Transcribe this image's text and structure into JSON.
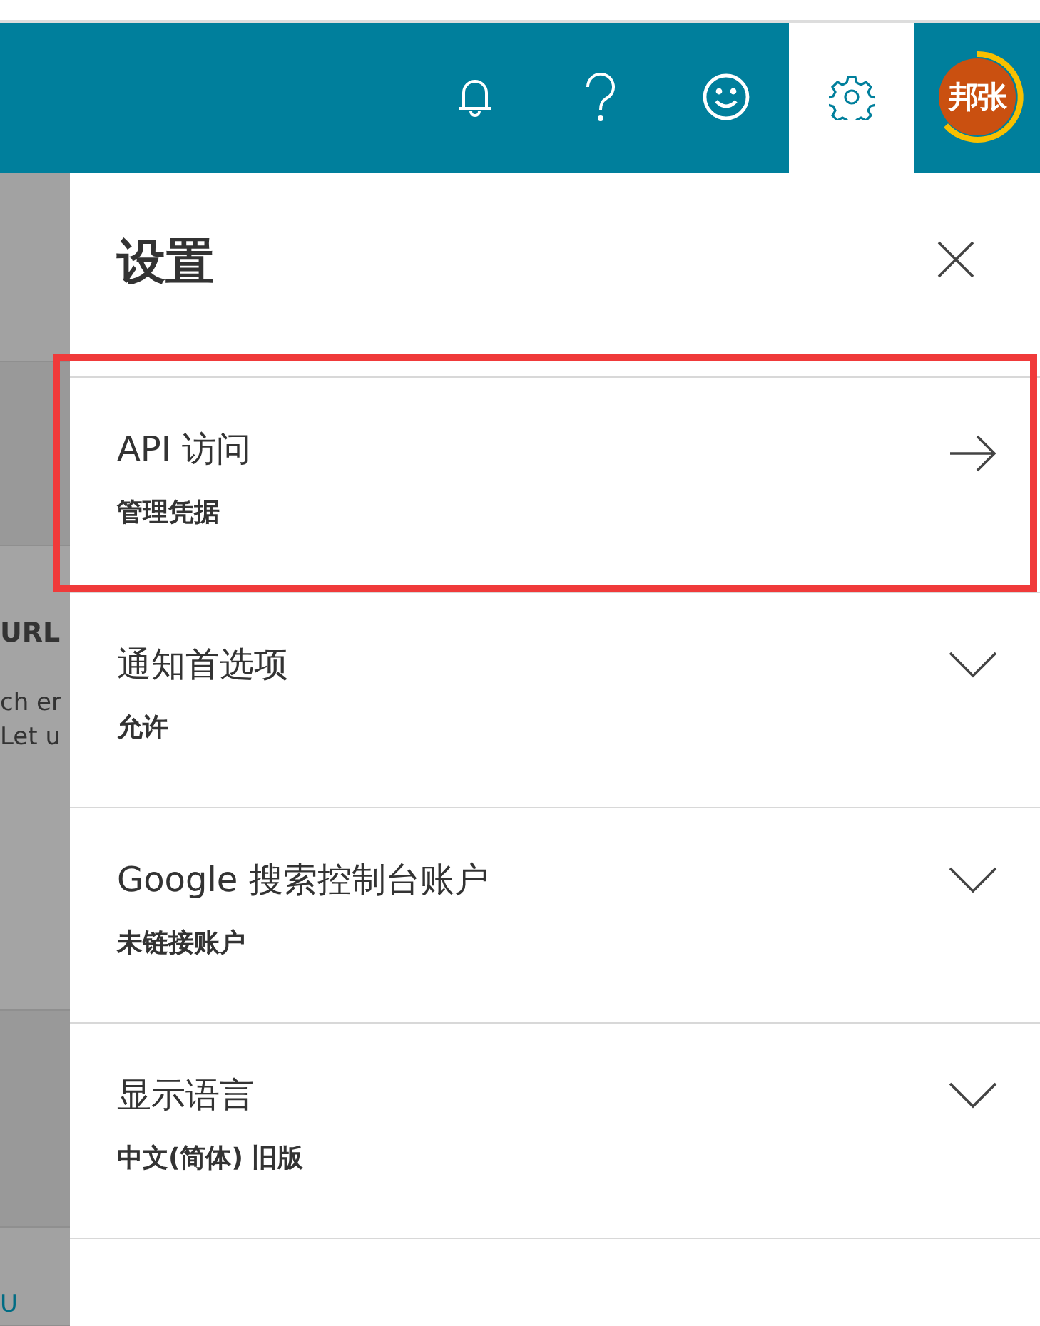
{
  "header": {
    "buttons": [
      {
        "kind": "bell",
        "selected": false
      },
      {
        "kind": "help",
        "selected": false
      },
      {
        "kind": "smile",
        "selected": false
      },
      {
        "kind": "gear",
        "selected": true
      }
    ],
    "avatar": {
      "initials": "邦张"
    }
  },
  "background": {
    "texts": [
      {
        "text": "URL",
        "kind": "heading"
      },
      {
        "text": "ch er",
        "kind": "body"
      },
      {
        "text": "Let  u",
        "kind": "body"
      },
      {
        "text": "U",
        "kind": "link"
      }
    ]
  },
  "panel": {
    "title": "设置",
    "items": [
      {
        "title": "API 访问",
        "value": "管理凭据",
        "kind": "arrow",
        "highlighted": true
      },
      {
        "title": "通知首选项",
        "value": "允许",
        "kind": "expand",
        "highlighted": false
      },
      {
        "title": "Google 搜索控制台账户",
        "value": "未链接账户",
        "kind": "expand",
        "highlighted": false
      },
      {
        "title": "显示语言",
        "value": "中文(简体) 旧版",
        "kind": "expand",
        "highlighted": false
      }
    ]
  }
}
